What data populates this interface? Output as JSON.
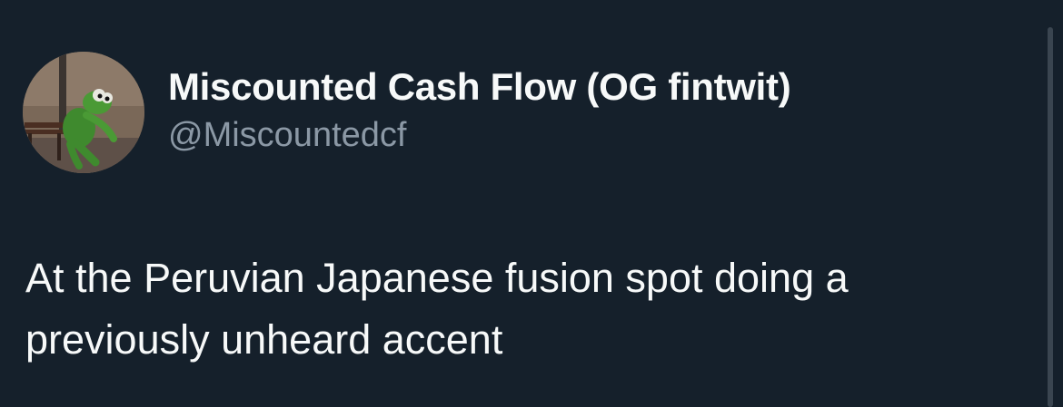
{
  "tweet": {
    "author": {
      "display_name": "Miscounted Cash Flow (OG fintwit)",
      "handle": "@Miscountedcf",
      "avatar_icon": "kermit-sitting-on-bench-avatar"
    },
    "text_lines": [
      "At the Peruvian Japanese fusion spot doing a",
      "previously unheard accent"
    ]
  },
  "colors": {
    "background": "#15202b",
    "primary_text": "#f7f9f9",
    "secondary_text": "#8b98a5"
  }
}
